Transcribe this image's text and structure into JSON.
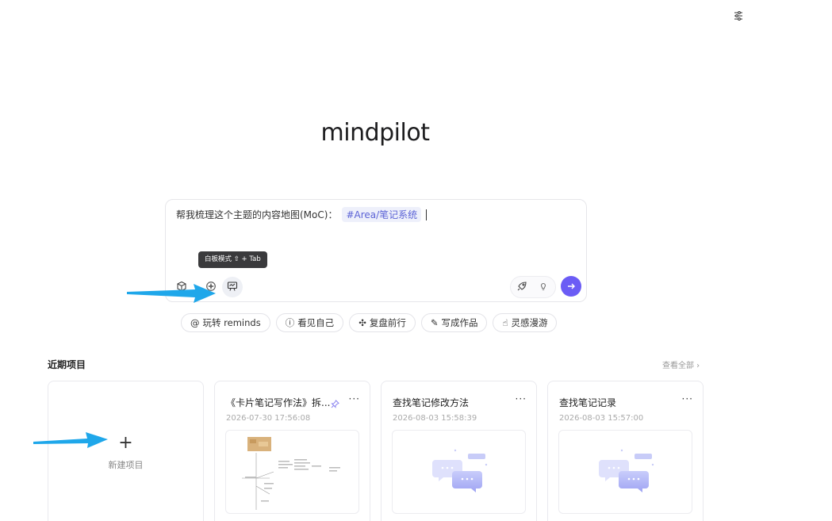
{
  "app": {
    "logo": "mindpilot"
  },
  "top_bar": {
    "settings_icon": "sliders-icon"
  },
  "prompt": {
    "text": "帮我梳理这个主题的内容地图(MoC)：",
    "tag": "#Area/笔记系统"
  },
  "tooltip": {
    "text": "白板模式 ⇧ + Tab"
  },
  "toolbar": {
    "left_icons": [
      "cube-icon",
      "sparkle-add-icon",
      "whiteboard-icon"
    ],
    "right_icons": [
      "rocket-icon",
      "bulb-icon"
    ],
    "send_icon": "arrow-right-icon",
    "accent_color": "#6b5cf5"
  },
  "quick_actions": [
    {
      "icon": "@",
      "label": "玩转 reminds"
    },
    {
      "icon": "ⓘ",
      "label": "看见自己"
    },
    {
      "icon": "✣",
      "label": "复盘前行"
    },
    {
      "icon": "✎",
      "label": "写成作品"
    },
    {
      "icon": "☝",
      "label": "灵感漫游"
    }
  ],
  "recent": {
    "title": "近期项目",
    "see_all": "查看全部 ›",
    "new_project": {
      "plus": "+",
      "label": "新建项目"
    },
    "projects": [
      {
        "title": "《卡片笔记写作法》拆...",
        "date": "2026-07-30 17:56:08",
        "pinned": true,
        "more": "···"
      },
      {
        "title": "查找笔记修改方法",
        "date": "2026-08-03 15:58:39",
        "pinned": false,
        "more": "···"
      },
      {
        "title": "查找笔记记录",
        "date": "2026-08-03 15:57:00",
        "pinned": false,
        "more": "···"
      }
    ]
  },
  "annotation_color": "#1fa7ea"
}
